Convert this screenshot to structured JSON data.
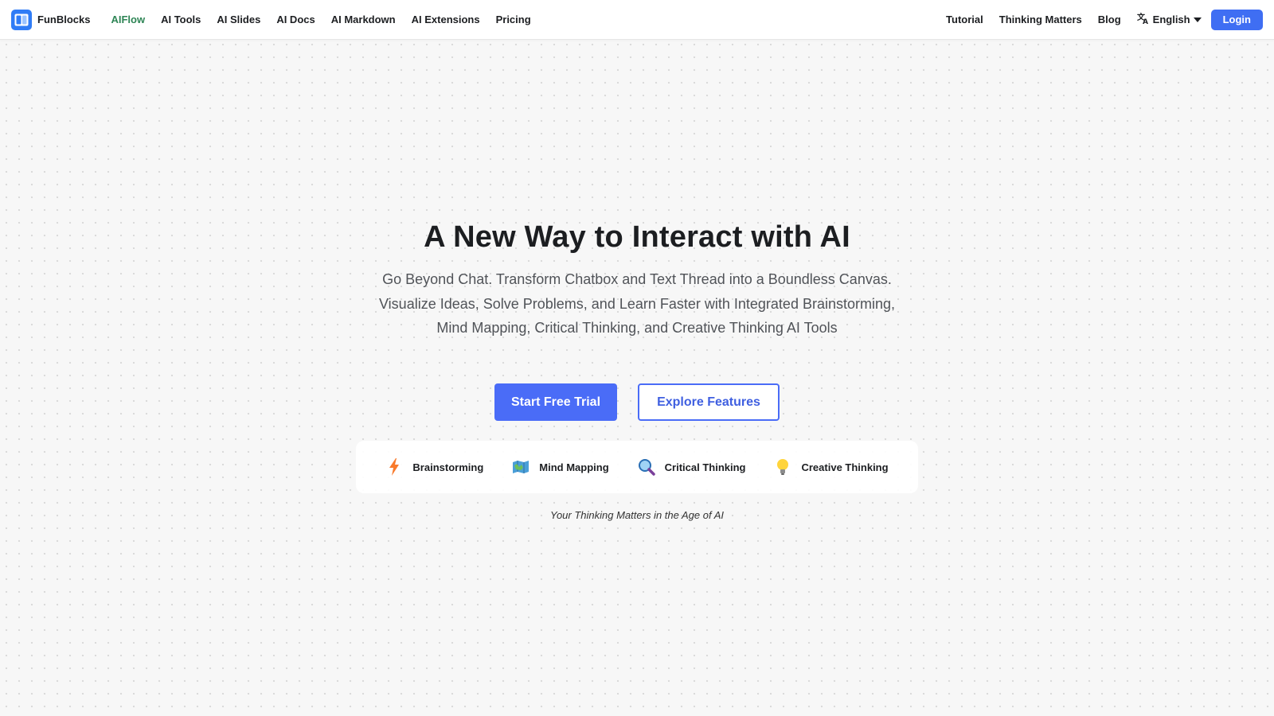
{
  "brand": {
    "name": "FunBlocks",
    "logo_icon": "funblocks-logo-icon"
  },
  "nav": {
    "left_items": [
      {
        "label": "AIFlow",
        "active": true
      },
      {
        "label": "AI Tools"
      },
      {
        "label": "AI Slides"
      },
      {
        "label": "AI Docs"
      },
      {
        "label": "AI Markdown"
      },
      {
        "label": "AI Extensions"
      },
      {
        "label": "Pricing"
      }
    ],
    "right_items": [
      {
        "label": "Tutorial"
      },
      {
        "label": "Thinking Matters"
      },
      {
        "label": "Blog"
      }
    ],
    "language": {
      "label": "English",
      "icon": "translate-icon"
    },
    "login_label": "Login"
  },
  "hero": {
    "title": "A New Way to Interact with AI",
    "subtitle_lines": [
      "Go Beyond Chat. Transform Chatbox and Text Thread into a Boundless Canvas.",
      "Visualize Ideas, Solve Problems, and Learn Faster with Integrated Brainstorming,",
      "Mind Mapping, Critical Thinking, and Creative Thinking AI Tools"
    ],
    "primary_cta": "Start Free Trial",
    "secondary_cta": "Explore Features",
    "features": [
      {
        "label": "Brainstorming",
        "icon": "lightning-icon"
      },
      {
        "label": "Mind Mapping",
        "icon": "map-icon"
      },
      {
        "label": "Critical Thinking",
        "icon": "magnifier-icon"
      },
      {
        "label": "Creative Thinking",
        "icon": "lightbulb-icon"
      }
    ],
    "tagline": "Your Thinking Matters in the Age of AI"
  },
  "colors": {
    "accent": "#3f6ef3",
    "active_nav": "#2e8555",
    "primary_button": "#4a6cf7"
  }
}
